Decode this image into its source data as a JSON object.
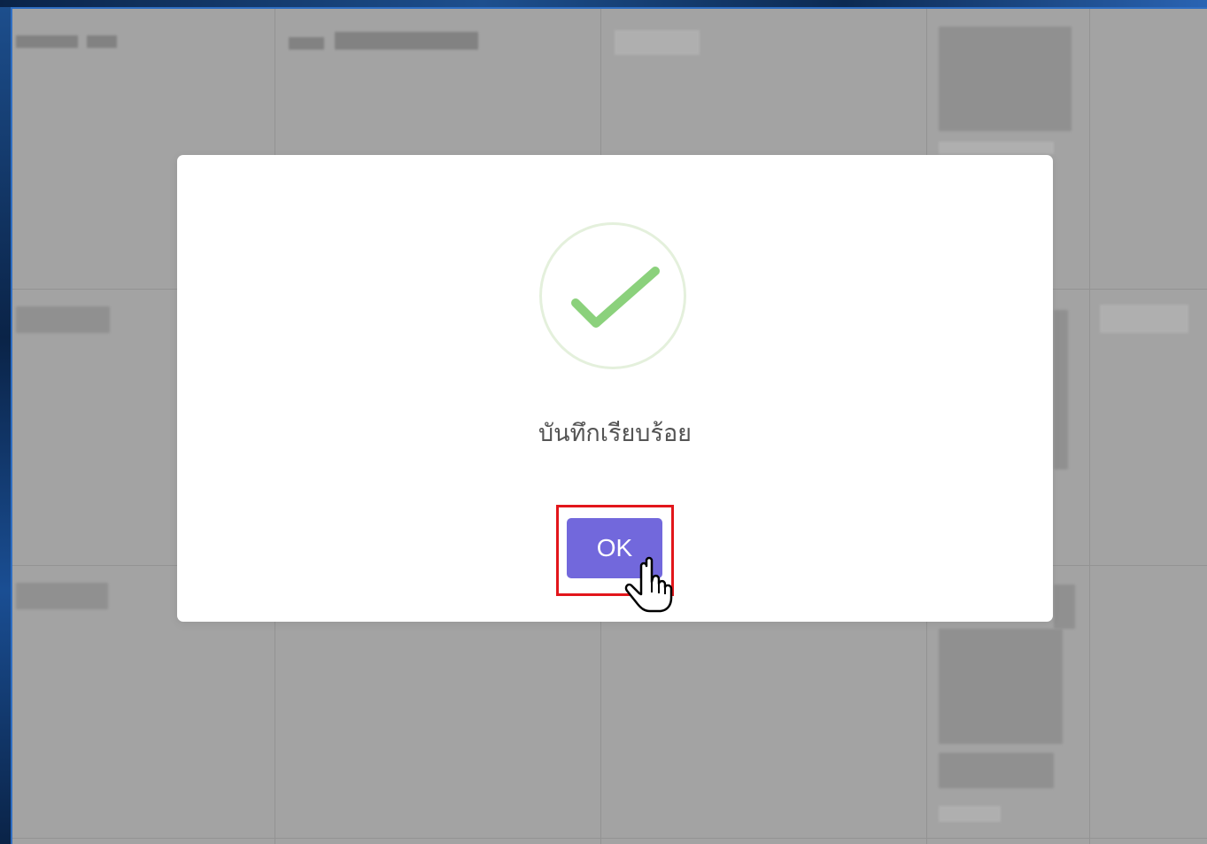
{
  "dialog": {
    "icon": "success-check-icon",
    "message": "บันทึกเรียบร้อย",
    "ok_label": "OK"
  },
  "colors": {
    "ok_button": "#7268dc",
    "check": "#8bd17c",
    "check_ring": "#e4f0dc",
    "highlight": "#e2161b",
    "overlay": "#a3a3a3"
  },
  "cursor": {
    "icon": "hand-pointer-icon"
  }
}
